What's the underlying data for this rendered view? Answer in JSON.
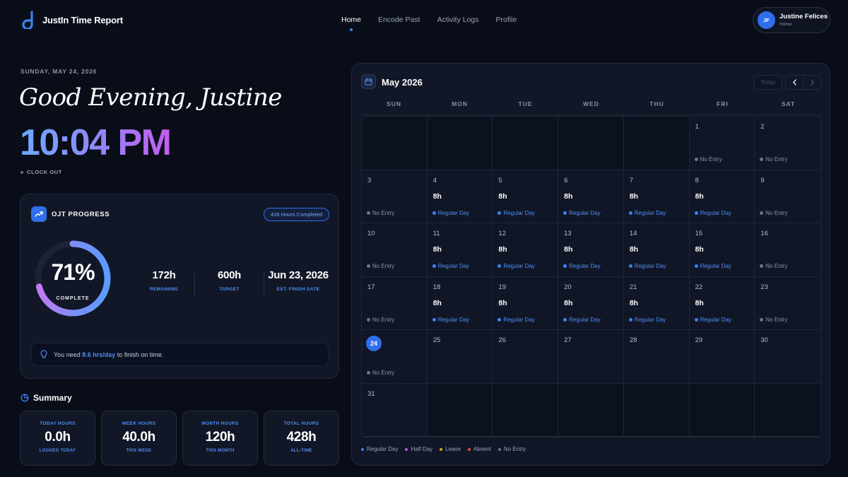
{
  "brand": {
    "name": "JustIn Time Report",
    "logo_icon": "d-logo-icon"
  },
  "nav": [
    {
      "label": "Home",
      "active": true
    },
    {
      "label": "Encode Past",
      "active": false
    },
    {
      "label": "Activity Logs",
      "active": false
    },
    {
      "label": "Profile",
      "active": false
    }
  ],
  "profile": {
    "initials": "JF",
    "name": "Justine Felices",
    "subtitle": "Home"
  },
  "header": {
    "date": "SUNDAY, MAY 24, 2026",
    "greeting": "Good Evening, Justine",
    "time": "10:04 PM",
    "clock_status": "CLOCK OUT"
  },
  "ojt": {
    "title": "OJT PROGRESS",
    "badge": "428 Hours Completed",
    "percent": 71,
    "percent_text": "71%",
    "percent_label": "COMPLETE",
    "stats": [
      {
        "value": "172h",
        "label": "REMAINING"
      },
      {
        "value": "600h",
        "label": "TARGET"
      },
      {
        "value": "Jun 23, 2026",
        "label": "EST. FINISH DATE"
      }
    ],
    "tip_prefix": "You need ",
    "tip_highlight": "8.6 hrs/day",
    "tip_suffix": " to finish on time."
  },
  "summary": {
    "title": "Summary",
    "cards": [
      {
        "label": "TODAY HOURS",
        "value": "0.0h",
        "sub": "LOGGED TODAY"
      },
      {
        "label": "WEEK HOURS",
        "value": "40.0h",
        "sub": "THIS WEEK"
      },
      {
        "label": "MONTH HOURS",
        "value": "120h",
        "sub": "THIS MONTH"
      },
      {
        "label": "TOTAL HOURS",
        "value": "428h",
        "sub": "ALL-TIME"
      }
    ]
  },
  "calendar": {
    "month": "May 2026",
    "today_label": "Today",
    "prev_icon": "chevron-left-icon",
    "next_icon": "chevron-right-icon",
    "weekdays": [
      "SUN",
      "MON",
      "TUE",
      "WED",
      "THU",
      "FRI",
      "SAT"
    ],
    "today_day": 24,
    "days": [
      null,
      null,
      null,
      null,
      null,
      {
        "day": "1",
        "hours": "",
        "status": "No Entry",
        "type": "none"
      },
      {
        "day": "2",
        "hours": "",
        "status": "No Entry",
        "type": "none"
      },
      {
        "day": "3",
        "hours": "",
        "status": "No Entry",
        "type": "none"
      },
      {
        "day": "4",
        "hours": "8h",
        "status": "Regular Day",
        "type": "regular"
      },
      {
        "day": "5",
        "hours": "8h",
        "status": "Regular Day",
        "type": "regular"
      },
      {
        "day": "6",
        "hours": "8h",
        "status": "Regular Day",
        "type": "regular"
      },
      {
        "day": "7",
        "hours": "8h",
        "status": "Regular Day",
        "type": "regular"
      },
      {
        "day": "8",
        "hours": "8h",
        "status": "Regular Day",
        "type": "regular"
      },
      {
        "day": "9",
        "hours": "",
        "status": "No Entry",
        "type": "none"
      },
      {
        "day": "10",
        "hours": "",
        "status": "No Entry",
        "type": "none"
      },
      {
        "day": "11",
        "hours": "8h",
        "status": "Regular Day",
        "type": "regular"
      },
      {
        "day": "12",
        "hours": "8h",
        "status": "Regular Day",
        "type": "regular"
      },
      {
        "day": "13",
        "hours": "8h",
        "status": "Regular Day",
        "type": "regular"
      },
      {
        "day": "14",
        "hours": "8h",
        "status": "Regular Day",
        "type": "regular"
      },
      {
        "day": "15",
        "hours": "8h",
        "status": "Regular Day",
        "type": "regular"
      },
      {
        "day": "16",
        "hours": "",
        "status": "No Entry",
        "type": "none"
      },
      {
        "day": "17",
        "hours": "",
        "status": "No Entry",
        "type": "none"
      },
      {
        "day": "18",
        "hours": "8h",
        "status": "Regular Day",
        "type": "regular"
      },
      {
        "day": "19",
        "hours": "8h",
        "status": "Regular Day",
        "type": "regular"
      },
      {
        "day": "20",
        "hours": "8h",
        "status": "Regular Day",
        "type": "regular"
      },
      {
        "day": "21",
        "hours": "8h",
        "status": "Regular Day",
        "type": "regular"
      },
      {
        "day": "22",
        "hours": "8h",
        "status": "Regular Day",
        "type": "regular"
      },
      {
        "day": "23",
        "hours": "",
        "status": "No Entry",
        "type": "none"
      },
      {
        "day": "24",
        "hours": "",
        "status": "No Entry",
        "type": "none"
      },
      {
        "day": "25",
        "hours": "",
        "status": "",
        "type": ""
      },
      {
        "day": "26",
        "hours": "",
        "status": "",
        "type": ""
      },
      {
        "day": "27",
        "hours": "",
        "status": "",
        "type": ""
      },
      {
        "day": "28",
        "hours": "",
        "status": "",
        "type": ""
      },
      {
        "day": "29",
        "hours": "",
        "status": "",
        "type": ""
      },
      {
        "day": "30",
        "hours": "",
        "status": "",
        "type": ""
      },
      {
        "day": "31",
        "hours": "",
        "status": "",
        "type": ""
      },
      null,
      null,
      null,
      null,
      null,
      null
    ],
    "legend": [
      {
        "label": "Regular Day",
        "color": "#3b82f6"
      },
      {
        "label": "Half Day",
        "color": "#a855f7"
      },
      {
        "label": "Leave",
        "color": "#f59e0b"
      },
      {
        "label": "Absent",
        "color": "#ef4444"
      },
      {
        "label": "No Entry",
        "color": "#6b7386"
      }
    ]
  },
  "colors": {
    "accent": "#2f6fed",
    "background": "#090d18",
    "card": "#111726"
  }
}
